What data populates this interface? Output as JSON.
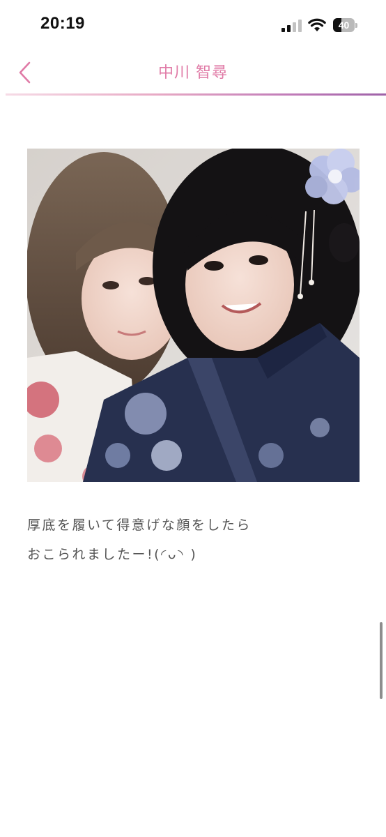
{
  "status_bar": {
    "time": "20:19",
    "battery_level": "40",
    "battery_fraction": 0.4,
    "icons": [
      "signal-icon",
      "wifi-icon",
      "battery-icon"
    ]
  },
  "header": {
    "back_icon": "chevron-left-icon",
    "title": "中川 智尋"
  },
  "post": {
    "photo_description": "photo",
    "text_lines": [
      "厚底を履いて得意げな顔をしたら",
      "おこられましたー!(◜ᴗ◝ )"
    ]
  },
  "colors": {
    "accent": "#e07aa6",
    "divider_end": "#9e62a8",
    "text": "#555555"
  }
}
